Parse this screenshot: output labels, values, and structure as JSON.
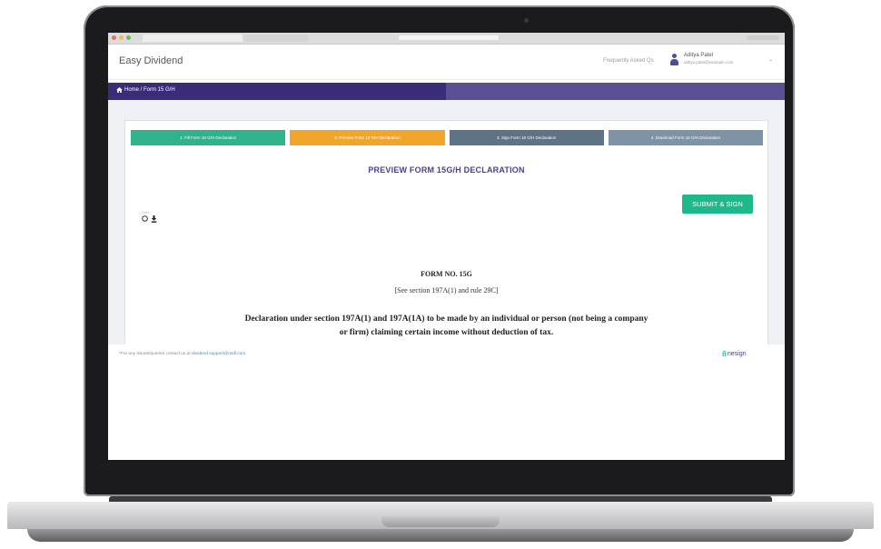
{
  "colors": {
    "brand_purple": "#3a2c78",
    "step1": "#2fb38b",
    "step2": "#f2a52b",
    "step3": "#5f7386",
    "step4": "#7d93a6",
    "submit": "#1db98a"
  },
  "browser": {
    "window_dots": [
      "#ec6b5e",
      "#f4bf4f",
      "#61c554"
    ]
  },
  "header": {
    "app_name": "Easy Dividend",
    "faq_link": "Frequently Asked Qs",
    "user_name": "Aditya Patel",
    "user_email": "aditya.patel@example.com",
    "menu_caret": "⌄"
  },
  "breadcrumb": {
    "icon": "home-icon",
    "text": "Home / Form 15 G/H"
  },
  "steps": [
    {
      "label": "1. Fill Form 15 G/H Declaration",
      "color": "#2fb38b"
    },
    {
      "label": "2. Preview Form 15 G/H Declaration",
      "color": "#f2a52b"
    },
    {
      "label": "3. Sign Form 15 G/H Declaration",
      "color": "#5f7386"
    },
    {
      "label": "4. Download Form 15 G/H Declaration",
      "color": "#7d93a6"
    }
  ],
  "document": {
    "title": "PREVIEW FORM 15G/H DECLARATION",
    "submit_label": "SUBMIT & SIGN",
    "tool_caption": "1 of 1",
    "tool_icons": [
      "print-icon",
      "download-icon"
    ],
    "form_number": "FORM NO. 15G",
    "form_reference": "[See section 197A(1) and rule 29C]",
    "declaration_line1": "Declaration under section 197A(1) and 197A(1A) to be made by an individual or person (not being a company",
    "declaration_line2": "or firm) claiming certain income without deduction of tax."
  },
  "footer": {
    "note": "*For any issues/queries contact us at ",
    "email": "dividend.support@nsdl.com",
    "logo_text": "nesign",
    "logo_mark": "ñ"
  }
}
